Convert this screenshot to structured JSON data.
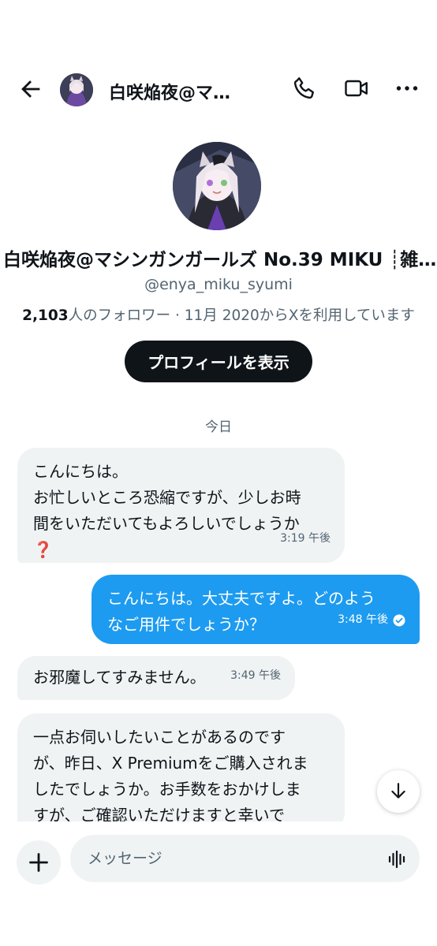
{
  "header": {
    "title": "白咲焔夜@マ…"
  },
  "profile": {
    "name": "白咲焔夜@マシンガンガールズ No.39 MIKU ┊雑…",
    "handle": "@enya_miku_syumi",
    "follower_count": "2,103",
    "follower_suffix": "人のフォロワー · 11月 2020からXを利用しています",
    "view_profile_label": "プロフィールを表示"
  },
  "date_divider": "今日",
  "messages": [
    {
      "direction": "incoming",
      "lines": [
        "こんにちは。",
        "お忙しいところ恐縮ですが、少しお時",
        "間をいただいてもよろしいでしょうか",
        "❓"
      ],
      "time": "3:19 午後"
    },
    {
      "direction": "outgoing",
      "lines": [
        "こんにちは。大丈夫ですよ。どのよう",
        "なご用件でしょうか？"
      ],
      "time": "3:48 午後",
      "status": "read"
    },
    {
      "direction": "incoming",
      "lines": [
        "お邪魔してすみません。"
      ],
      "time": "3:49 午後"
    },
    {
      "direction": "incoming",
      "lines": [
        "一点お伺いしたいことがあるのです",
        "が、昨日、X Premiumをご購入されま",
        "したでしょうか。お手数をおかけしま",
        "すが、ご確認いただけますと幸いで"
      ],
      "time": ""
    }
  ],
  "composer": {
    "placeholder": "メッセージ"
  },
  "colors": {
    "accent": "#1d9bf0",
    "incoming_bubble": "#eff3f4",
    "text": "#0f1419",
    "secondary_text": "#536471"
  },
  "icons": [
    "back-arrow-icon",
    "phone-icon",
    "video-camera-icon",
    "more-dots-icon",
    "arrow-down-icon",
    "plus-icon",
    "voice-waveform-icon",
    "read-check-icon"
  ]
}
